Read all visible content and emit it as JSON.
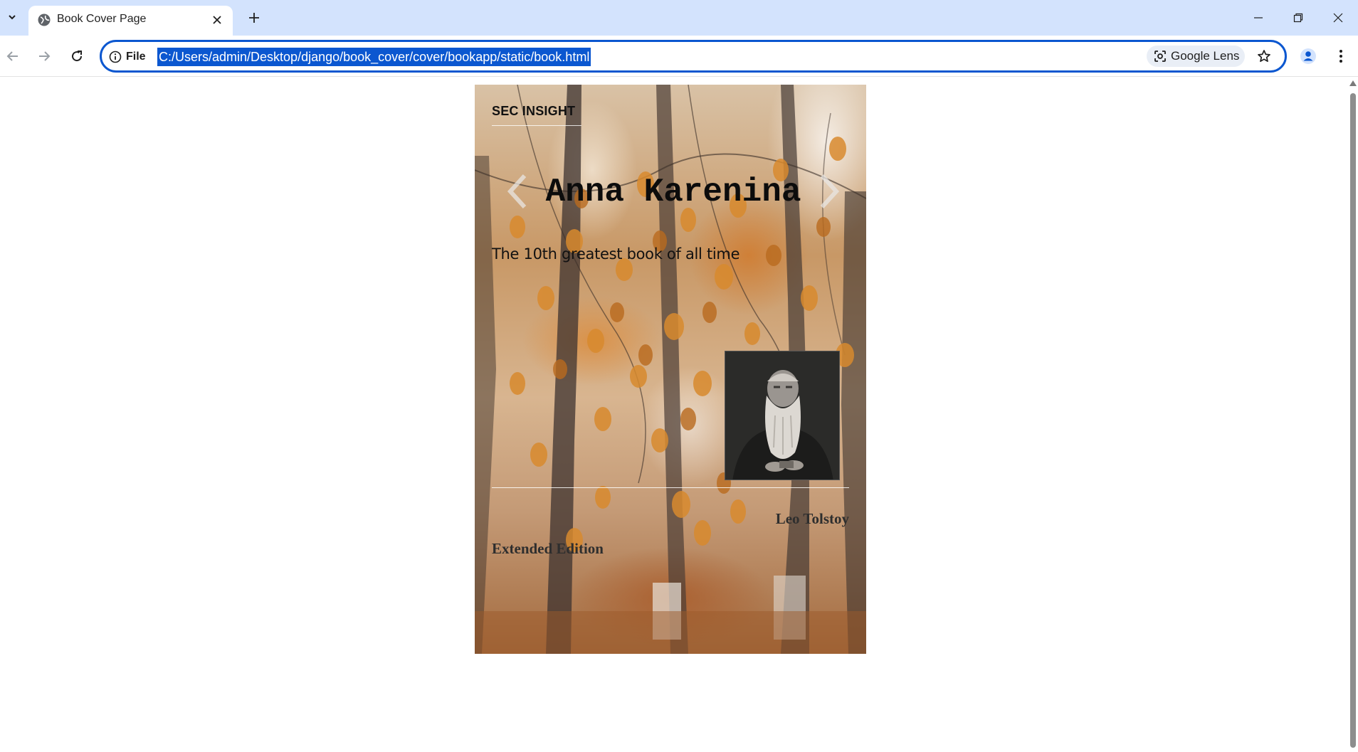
{
  "browser": {
    "tab_title": "Book Cover Page",
    "site_info_label": "File",
    "url": "C:/Users/admin/Desktop/django/book_cover/cover/bookapp/static/book.html",
    "lens_label": "Google Lens",
    "accent_color": "#0b57d0",
    "tabbar_color": "#d3e3fd"
  },
  "cover": {
    "publisher": "SEC INSIGHT",
    "title": "Anna Karenina",
    "subtitle": "The 10th greatest book of all time",
    "author": "Leo Tolstoy",
    "edition": "Extended Edition",
    "portrait_image": "bearded-old-man-portrait",
    "background_image": "autumn-birch-trees"
  }
}
